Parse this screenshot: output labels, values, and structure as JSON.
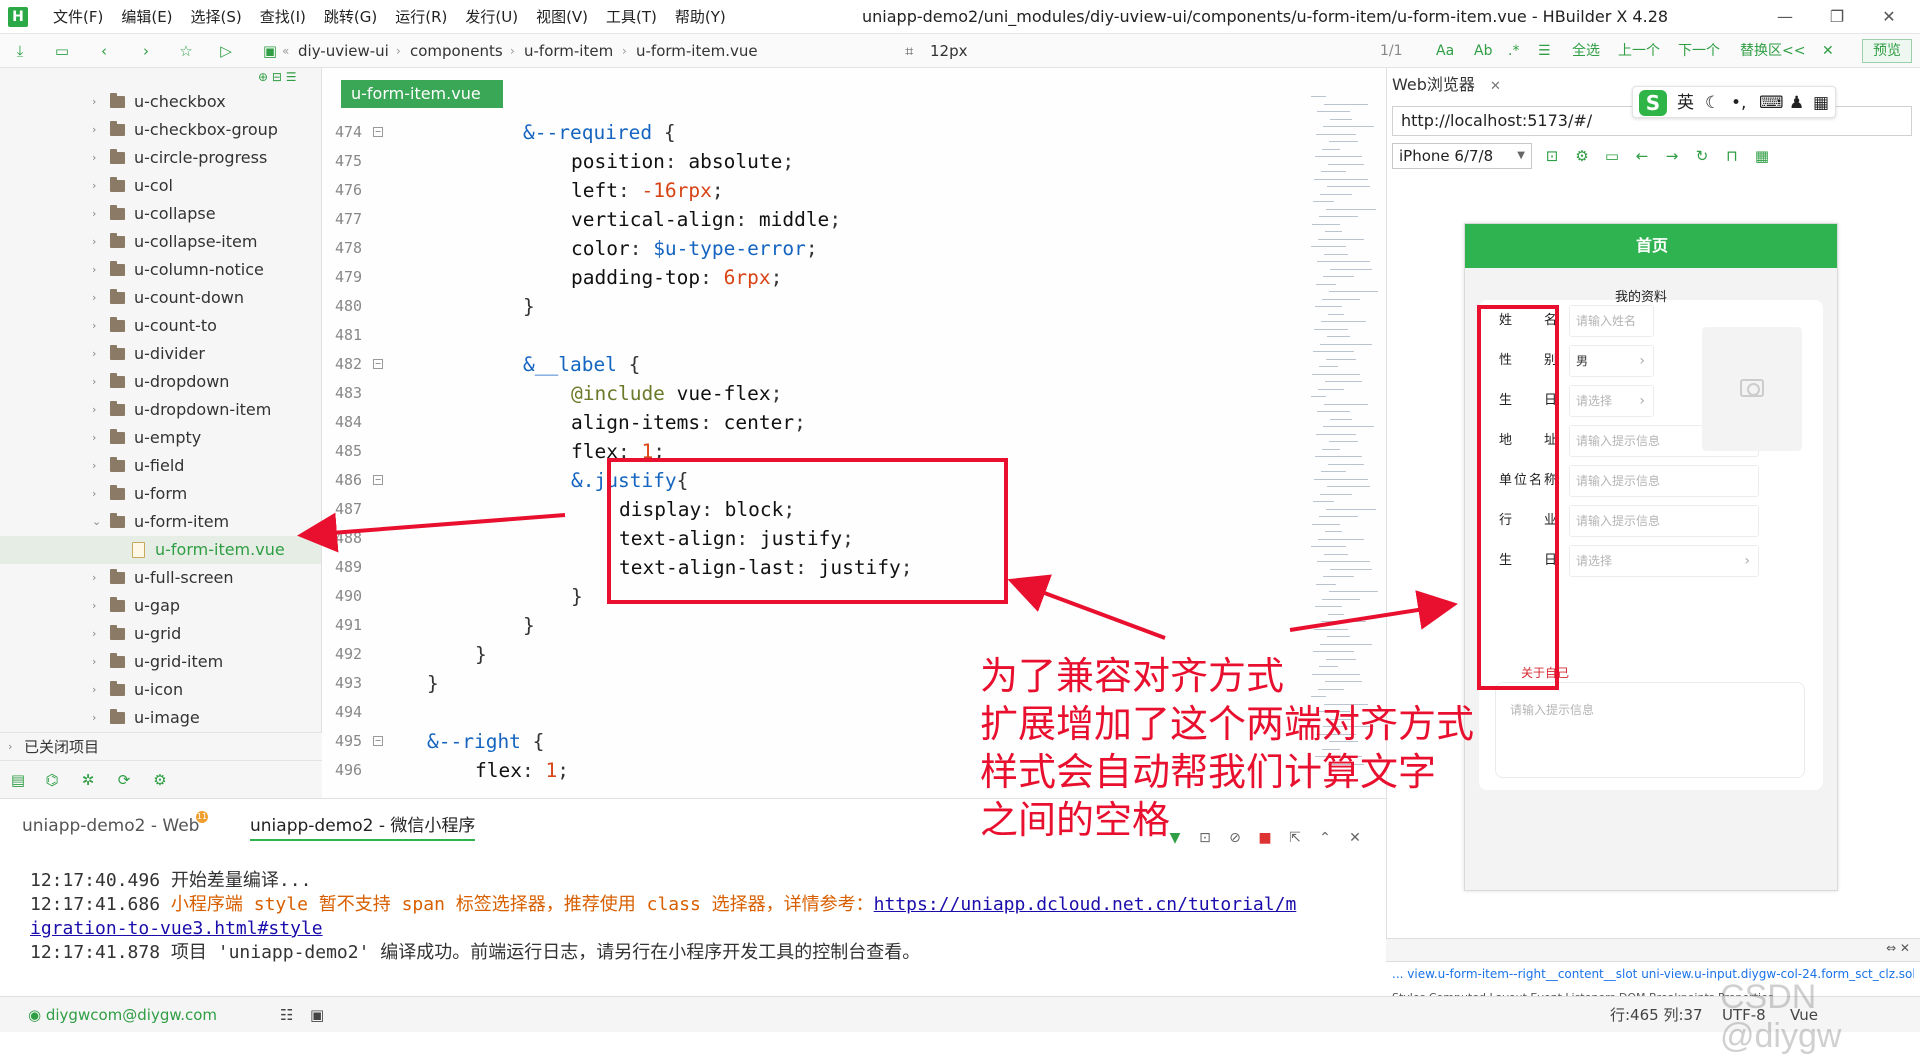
{
  "app": {
    "logo": "H",
    "title": "uniapp-demo2/uni_modules/diy-uview-ui/components/u-form-item/u-form-item.vue - HBuilder X 4.28",
    "menu": [
      "文件(F)",
      "编辑(E)",
      "选择(S)",
      "查找(I)",
      "跳转(G)",
      "运行(R)",
      "发行(U)",
      "视图(V)",
      "工具(T)",
      "帮助(Y)"
    ]
  },
  "toolbar": {
    "breadcrumb": [
      "diy-uview-ui",
      "components",
      "u-form-item",
      "u-form-item.vue"
    ],
    "font_size": "12px",
    "search_count": "1/1",
    "case_toggle": "Aa",
    "word_toggle": "Ab",
    "select_all": "全选",
    "prev": "上一个",
    "next": "下一个",
    "replace": "替换区<<",
    "preview": "预览"
  },
  "filetree": {
    "items": [
      {
        "label": "u-checkbox",
        "type": "folder"
      },
      {
        "label": "u-checkbox-group",
        "type": "folder"
      },
      {
        "label": "u-circle-progress",
        "type": "folder"
      },
      {
        "label": "u-col",
        "type": "folder"
      },
      {
        "label": "u-collapse",
        "type": "folder"
      },
      {
        "label": "u-collapse-item",
        "type": "folder"
      },
      {
        "label": "u-column-notice",
        "type": "folder"
      },
      {
        "label": "u-count-down",
        "type": "folder"
      },
      {
        "label": "u-count-to",
        "type": "folder"
      },
      {
        "label": "u-divider",
        "type": "folder"
      },
      {
        "label": "u-dropdown",
        "type": "folder"
      },
      {
        "label": "u-dropdown-item",
        "type": "folder"
      },
      {
        "label": "u-empty",
        "type": "folder"
      },
      {
        "label": "u-field",
        "type": "folder"
      },
      {
        "label": "u-form",
        "type": "folder"
      },
      {
        "label": "u-form-item",
        "type": "folder-open"
      },
      {
        "label": "u-form-item.vue",
        "type": "file"
      },
      {
        "label": "u-full-screen",
        "type": "folder"
      },
      {
        "label": "u-gap",
        "type": "folder"
      },
      {
        "label": "u-grid",
        "type": "folder"
      },
      {
        "label": "u-grid-item",
        "type": "folder"
      },
      {
        "label": "u-icon",
        "type": "folder"
      },
      {
        "label": "u-image",
        "type": "folder"
      }
    ],
    "closed_projects": "已关闭项目"
  },
  "editor": {
    "tab": "u-form-item.vue",
    "lines": [
      {
        "n": "474",
        "fold": true
      },
      {
        "n": "475"
      },
      {
        "n": "476"
      },
      {
        "n": "477"
      },
      {
        "n": "478"
      },
      {
        "n": "479"
      },
      {
        "n": "480"
      },
      {
        "n": "481"
      },
      {
        "n": "482",
        "fold": true
      },
      {
        "n": "483"
      },
      {
        "n": "484"
      },
      {
        "n": "485"
      },
      {
        "n": "486",
        "fold": true
      },
      {
        "n": "487"
      },
      {
        "n": "488"
      },
      {
        "n": "489"
      },
      {
        "n": "490"
      },
      {
        "n": "491"
      },
      {
        "n": "492"
      },
      {
        "n": "493"
      },
      {
        "n": "494"
      },
      {
        "n": "495",
        "fold": true
      },
      {
        "n": "496"
      }
    ]
  },
  "browser": {
    "tab": "Web浏览器",
    "url": "http://localhost:5173/#/",
    "device": "iPhone 6/7/8",
    "ime": {
      "mode": "英"
    },
    "phone": {
      "nav_title": "首页",
      "card_title": "我的资料",
      "fields": [
        {
          "label": "姓名",
          "placeholder": "请输入姓名",
          "value": ""
        },
        {
          "label": "性别",
          "placeholder": "",
          "value": "男"
        },
        {
          "label": "生日",
          "placeholder": "请选择",
          "value": ""
        },
        {
          "label": "地址",
          "placeholder": "请输入提示信息",
          "value": ""
        },
        {
          "label": "单位名称",
          "placeholder": "请输入提示信息",
          "value": ""
        },
        {
          "label": "行业",
          "placeholder": "请输入提示信息",
          "value": ""
        },
        {
          "label": "生日",
          "placeholder": "请选择",
          "value": ""
        }
      ],
      "about_label": "关于自己",
      "about_placeholder": "请输入提示信息"
    },
    "devtools_crumb": "... view.u-form-item--right__content__slot   uni-view.u-input.diygw-col-24.form_sct_clz.solid",
    "devtools_tabs": "Styles   Computed   Layout   Event Listeners   DOM Breakpoints   Properties"
  },
  "console": {
    "tabs": [
      "uniapp-demo2 - Web",
      "uniapp-demo2 - 微信小程序"
    ],
    "badge": "11",
    "logs": [
      {
        "time": "12:17:40.496",
        "text": "开始差量编译..."
      },
      {
        "time": "12:17:41.686",
        "text": "小程序端 style 暂不支持 span 标签选择器，推荐使用 class 选择器，详情参考：",
        "link": "https://uniapp.dcloud.net.cn/tutorial/m",
        "link2": "igration-to-vue3.html#style"
      },
      {
        "time": "12:17:41.878",
        "text": "项目 'uniapp-demo2' 编译成功。前端运行日志，请另行在小程序开发工具的控制台查看。"
      }
    ]
  },
  "statusbar": {
    "user": "diygwcom@diygw.com",
    "position": "行:465  列:37",
    "encoding": "UTF-8",
    "lang": "Vue"
  },
  "annotation": {
    "lines": [
      "为了兼容对齐方式",
      "扩展增加了这个两端对齐方式",
      "样式会自动帮我们计算文字",
      "之间的空格"
    ],
    "watermark": "CSDN @diygw"
  },
  "colors": {
    "accent": "#2fb350",
    "annotation_red": "#e8102e"
  }
}
